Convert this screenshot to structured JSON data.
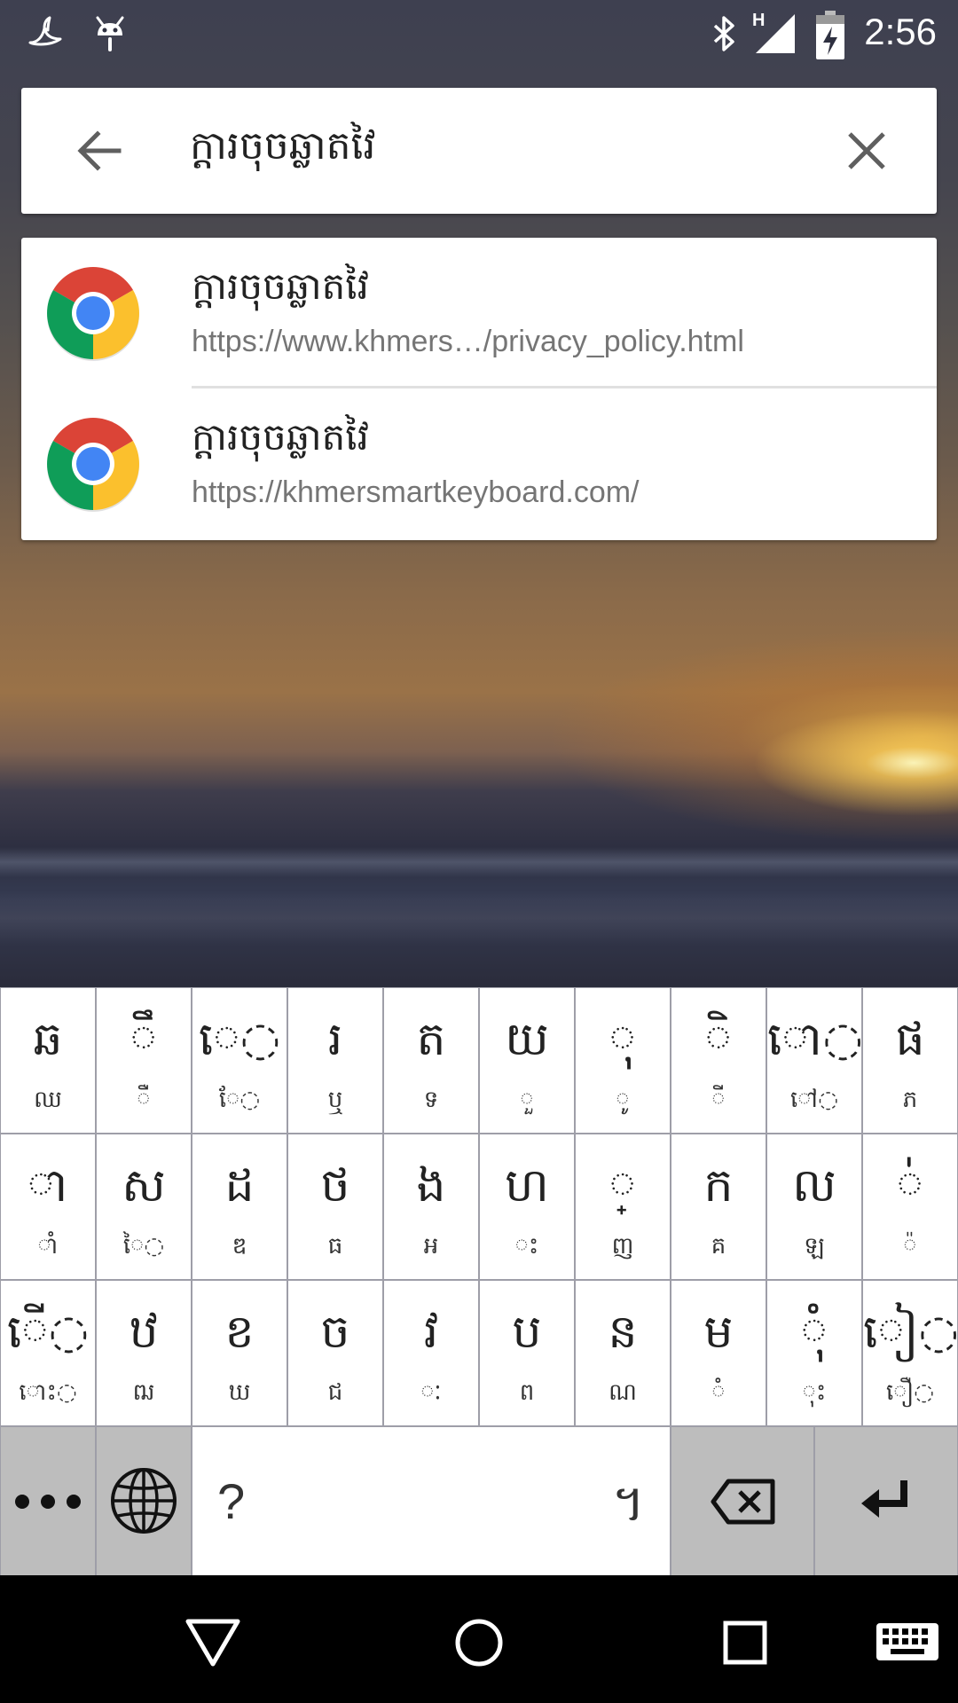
{
  "status_bar": {
    "time": "2:56",
    "network_type": "H",
    "icons": [
      "swallow-app-icon",
      "android-debug-icon",
      "bluetooth-icon",
      "signal-icon",
      "battery-charging-icon"
    ]
  },
  "search": {
    "query": "ក្ដារចុចឆ្លាតវៃ",
    "back_icon": "arrow-back-icon",
    "clear_icon": "close-icon"
  },
  "suggestions": [
    {
      "title": "ក្ដារចុចឆ្លាតវៃ",
      "url": "https://www.khmers…/privacy_policy.html",
      "icon": "chrome-icon"
    },
    {
      "title": "ក្ដារចុចឆ្លាតវៃ",
      "url": "https://khmersmartkeyboard.com/",
      "icon": "chrome-icon"
    }
  ],
  "keyboard": {
    "rows": [
      [
        {
          "main": "ឆ",
          "sub": "ឈ"
        },
        {
          "main": "◌ឹ",
          "sub": "◌ឺ"
        },
        {
          "main": "េ◌",
          "sub": "ែ◌"
        },
        {
          "main": "រ",
          "sub": "ឬ"
        },
        {
          "main": "ត",
          "sub": "ទ"
        },
        {
          "main": "យ",
          "sub": "◌ួ"
        },
        {
          "main": "◌ុ",
          "sub": "◌ូ"
        },
        {
          "main": "◌ិ",
          "sub": "◌ី"
        },
        {
          "main": "ោ◌",
          "sub": "ៅ◌"
        },
        {
          "main": "ផ",
          "sub": "ភ"
        }
      ],
      [
        {
          "main": "◌ា",
          "sub": "◌ាំ"
        },
        {
          "main": "ស",
          "sub": "ៃ◌"
        },
        {
          "main": "ដ",
          "sub": "ឌ"
        },
        {
          "main": "ថ",
          "sub": "ធ"
        },
        {
          "main": "ង",
          "sub": "អ"
        },
        {
          "main": "ហ",
          "sub": "◌ះ"
        },
        {
          "main": "◌្",
          "sub": "ញ"
        },
        {
          "main": "ក",
          "sub": "គ"
        },
        {
          "main": "ល",
          "sub": "ឡ"
        },
        {
          "main": "◌់",
          "sub": "◌៉"
        }
      ],
      [
        {
          "main": "ើ◌",
          "sub": "ោះ◌"
        },
        {
          "main": "ឋ",
          "sub": "ឍ"
        },
        {
          "main": "ខ",
          "sub": "ឃ"
        },
        {
          "main": "ច",
          "sub": "ជ"
        },
        {
          "main": "វ",
          "sub": "◌ៈ"
        },
        {
          "main": "ប",
          "sub": "ព"
        },
        {
          "main": "ន",
          "sub": "ណ"
        },
        {
          "main": "ម",
          "sub": "◌ំ"
        },
        {
          "main": "◌ុំ",
          "sub": "◌ុះ"
        },
        {
          "main": "ៀ◌",
          "sub": "ឿ◌"
        }
      ]
    ],
    "bottom_row": {
      "more_icon": "more-horiz-icon",
      "language_icon": "globe-icon",
      "space_left": "?",
      "space_right": "។",
      "backspace_icon": "backspace-icon",
      "enter_icon": "enter-icon"
    }
  },
  "nav_bar": {
    "buttons": [
      "back-triangle-icon",
      "home-circle-icon",
      "recents-square-icon",
      "keyboard-switch-icon"
    ]
  },
  "colors": {
    "keyboard_key": "#ffffff",
    "keyboard_gap": "#9e9ea8",
    "function_key": "#bdbdbd",
    "nav_bar": "#000000",
    "url_gray": "#757575"
  }
}
